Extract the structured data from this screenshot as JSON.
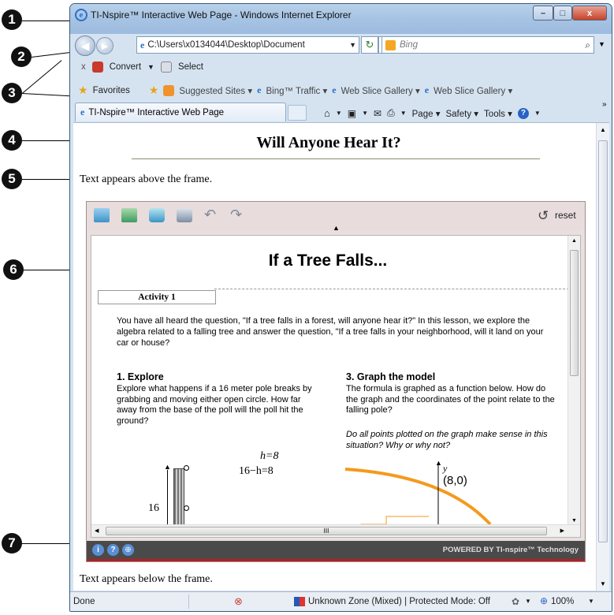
{
  "callouts": [
    "1",
    "2",
    "3",
    "4",
    "5",
    "6",
    "7"
  ],
  "window": {
    "title": "TI-Nspire™ Interactive Web Page - Windows Internet Explorer",
    "address": "C:\\Users\\x0134044\\Desktop\\Document",
    "search_placeholder": "Bing",
    "controls": {
      "minimize": "–",
      "maximize": "□",
      "close": "x"
    }
  },
  "command_bar": {
    "close": "x",
    "convert": "Convert",
    "select": "Select"
  },
  "favorites_bar": {
    "favorites": "Favorites",
    "items": [
      "Suggested Sites ▾",
      "Bing™ Traffic ▾",
      "Web Slice Gallery ▾",
      "Web Slice Gallery ▾"
    ]
  },
  "tab": {
    "label": "TI-Nspire™ Interactive Web Page"
  },
  "page_menu": [
    "Page ▾",
    "Safety ▾",
    "Tools ▾"
  ],
  "page": {
    "heading": "Will Anyone Hear It?",
    "text_above": "Text appears above the frame.",
    "text_below": "Text appears below the frame."
  },
  "frame": {
    "reset": "reset",
    "title": "If a Tree Falls...",
    "activity_tab": "Activity 1",
    "intro": "You have all heard the question, \"If a tree falls in a forest, will anyone hear it?\" In this lesson, we explore the algebra related to a falling tree and answer the question, \"If a tree falls in your neighborhood, will it land on your car or house?",
    "explore": {
      "heading": "1. Explore",
      "body": "Explore what happens if a 16 meter pole breaks by grabbing and moving either open circle. How far away from the base of the poll will the poll hit the ground?",
      "eq1": "h=8",
      "eq2": "16−h=8",
      "pole_label": "16"
    },
    "graph": {
      "heading": "3. Graph the model",
      "body": "The formula is graphed as a function below. How do the graph and the coordinates of the point relate to the falling pole?",
      "question": "Do all points plotted on the graph make sense in this situation? Why or why not?",
      "y_label": "y",
      "point": "(8,0)"
    },
    "footer": "POWERED BY TI-nspire™ Technology",
    "scroll_mid": "III"
  },
  "status": {
    "left": "Done",
    "zone": "Unknown Zone (Mixed) | Protected Mode: Off",
    "zoom": "100%"
  },
  "colors": {
    "accent_orange": "#f39a1e",
    "footer_red": "#b41e23",
    "titlebar": "#a6c3e3"
  }
}
